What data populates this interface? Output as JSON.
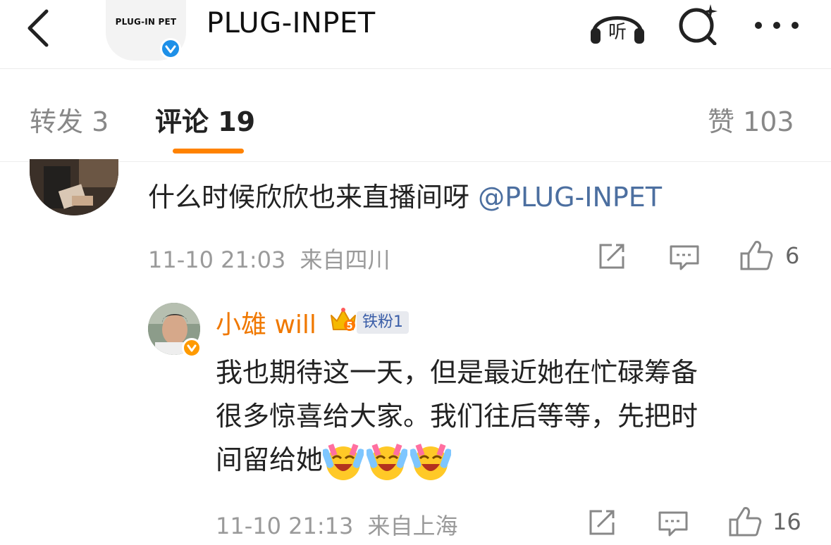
{
  "header": {
    "logo_text": "PLUG-IN PET",
    "title": "PLUG-INPET",
    "listen_label": "听",
    "icons": [
      "back-icon",
      "listen-icon",
      "search-icon",
      "more-icon"
    ]
  },
  "tabs": {
    "repost": "转发 3",
    "comments": "评论 19",
    "likes": "赞 103"
  },
  "comment1": {
    "text": "什么时候欣欣也来直播间呀 ",
    "mention": "@PLUG-INPET",
    "time": "11-10 21:03",
    "location": "来自四川",
    "like_count": "6"
  },
  "comment2": {
    "username": "小雄 will",
    "fan_badge": "铁粉1",
    "crown_level": "5",
    "text_line1": "我也期待这一天，但是最近她在忙碌筹备",
    "text_line2": "很多惊喜给大家。我们往后等等，先把时",
    "text_line3": "间留给她",
    "time": "11-10 21:13",
    "location": "来自上海",
    "like_count": "16"
  },
  "colors": {
    "accent": "#ff8200",
    "mention": "#4c6fa0",
    "username": "#f07800",
    "verified": "#1e90e8"
  }
}
